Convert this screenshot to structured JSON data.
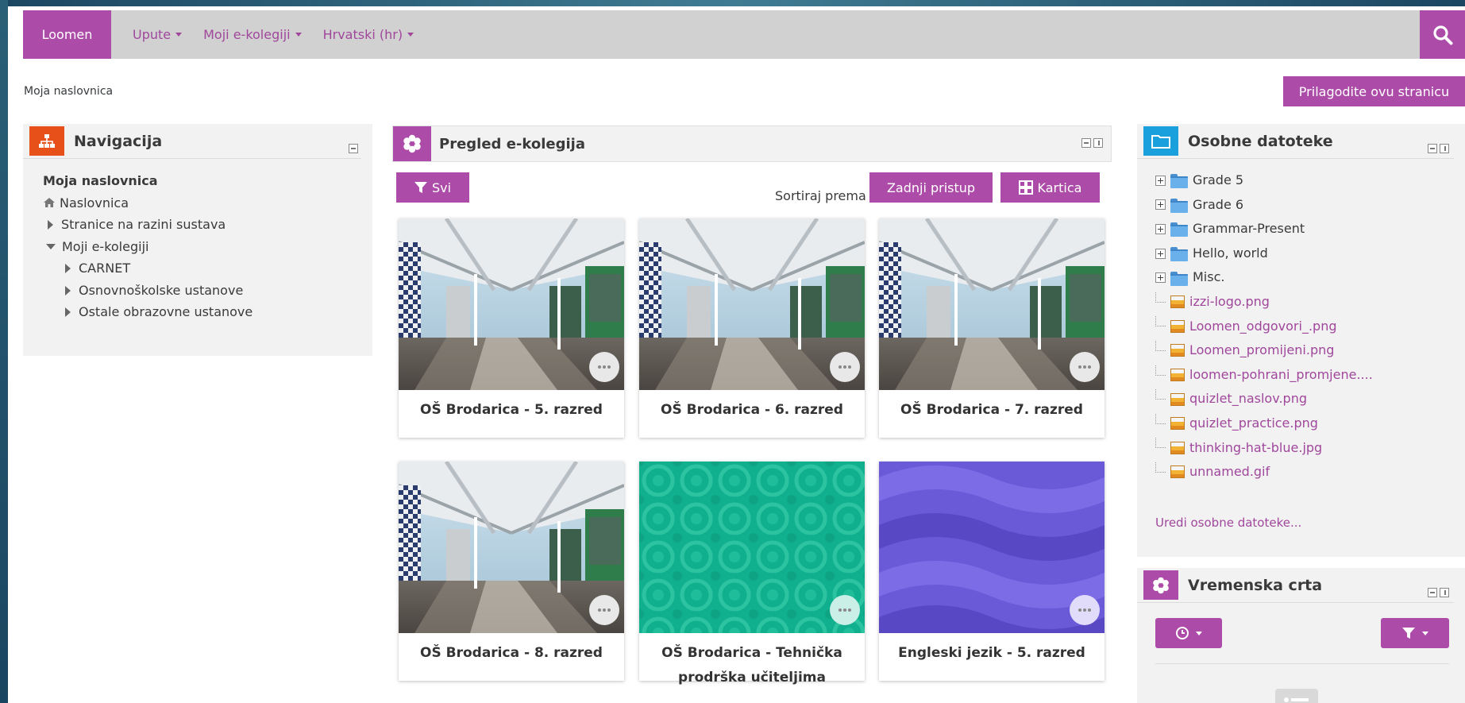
{
  "navbar": {
    "brand": "Loomen",
    "items": [
      {
        "label": "Upute"
      },
      {
        "label": "Moji e-kolegiji"
      },
      {
        "label": "Hrvatski (hr)"
      }
    ],
    "search_icon": "search-icon"
  },
  "breadcrumb": "Moja naslovnica",
  "customize_button": "Prilagodite ovu stranicu",
  "navigation": {
    "title": "Navigacija",
    "root": "Moja naslovnica",
    "home": "Naslovnica",
    "site_pages": "Stranice na razini sustava",
    "my_courses": "Moji e-kolegiji",
    "children": [
      "CARNET",
      "Osnovnoškolske ustanove",
      "Ostale obrazovne ustanove"
    ]
  },
  "course_overview": {
    "title": "Pregled e-kolegija",
    "filter_label": "Svi",
    "sort_label": "Sortiraj prema",
    "sort_value": "Zadnji pristup",
    "view_value": "Kartica",
    "courses": [
      {
        "name": "OŠ Brodarica - 5. razred",
        "image": "photo"
      },
      {
        "name": "OŠ Brodarica - 6. razred",
        "image": "photo"
      },
      {
        "name": "OŠ Brodarica - 7. razred",
        "image": "photo"
      },
      {
        "name": "OŠ Brodarica - 8. razred",
        "image": "photo"
      },
      {
        "name": "OŠ Brodarica - Tehnička prodrška učiteljima",
        "image": "teal-circles"
      },
      {
        "name": "Engleski jezik - 5. razred",
        "image": "violet-waves"
      }
    ]
  },
  "private_files": {
    "title": "Osobne datoteke",
    "folders": [
      "Grade 5",
      "Grade 6",
      "Grammar-Present",
      "Hello, world",
      "Misc."
    ],
    "files": [
      "izzi-logo.png",
      "Loomen_odgovori_.png",
      "Loomen_promijeni.png",
      "loomen-pohrani_promjene....",
      "quizlet_naslov.png",
      "quizlet_practice.png",
      "thinking-hat-blue.jpg",
      "unnamed.gif"
    ],
    "edit_link": "Uredi osobne datoteke..."
  },
  "timeline": {
    "title": "Vremenska crta"
  },
  "colors": {
    "accent": "#ad4ca8",
    "navbar_bg": "#d1d1d1",
    "nav_icon_orange": "#e8501a",
    "files_icon_blue": "#1aa0dc"
  }
}
